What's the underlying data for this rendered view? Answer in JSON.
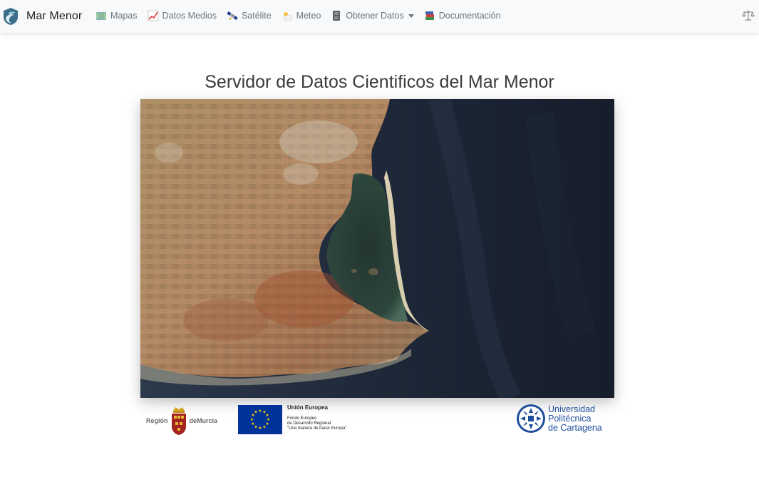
{
  "navbar": {
    "brand": "Mar Menor",
    "items": [
      {
        "label": "Mapas",
        "icon": "map-icon"
      },
      {
        "label": "Datos Medios",
        "icon": "chart-icon"
      },
      {
        "label": "Satélite",
        "icon": "satellite-icon"
      },
      {
        "label": "Meteo",
        "icon": "cloud-icon"
      },
      {
        "label": "Obtener Datos",
        "icon": "file-cabinet-icon",
        "dropdown": true
      },
      {
        "label": "Documentación",
        "icon": "books-icon"
      }
    ],
    "right_icon": "scale-icon"
  },
  "main": {
    "title": "Servidor de Datos Cientificos del Mar Menor",
    "image": "satellite-image-mar-menor"
  },
  "logos": {
    "murcia": {
      "left": "Región",
      "right": "deMurcia"
    },
    "eu": {
      "title": "Unión Europea",
      "line1": "Fondo Europeo",
      "line2": "de Desarrollo Regional",
      "line3": "\"Una manera de hacer Europa\""
    },
    "upct": {
      "line1": "Universidad",
      "line2": "Politécnica",
      "line3": "de Cartagena"
    }
  },
  "colors": {
    "navbar_bg": "#f8f9fa",
    "nav_text": "#6c757d",
    "eu_blue": "#003399",
    "upct_blue": "#1e4f9c"
  }
}
